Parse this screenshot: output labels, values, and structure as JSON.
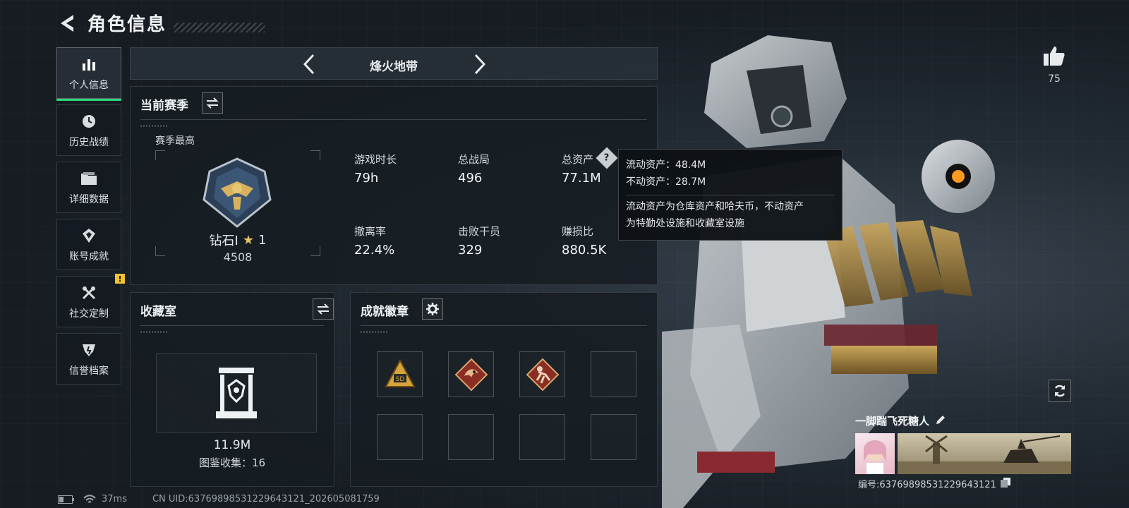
{
  "header": {
    "title": "角色信息"
  },
  "sidebar": {
    "items": [
      {
        "label": "个人信息",
        "icon": "bar-chart-icon",
        "active": true
      },
      {
        "label": "历史战绩",
        "icon": "clock-icon"
      },
      {
        "label": "详细数据",
        "icon": "folder-icon"
      },
      {
        "label": "账号成就",
        "icon": "achievement-icon"
      },
      {
        "label": "社交定制",
        "icon": "tools-icon",
        "badge": "!"
      },
      {
        "label": "信誉档案",
        "icon": "shield-icon"
      }
    ]
  },
  "mode": {
    "title": "烽火地带"
  },
  "season": {
    "title": "当前赛季",
    "best_label": "赛季最高",
    "rank_name": "钻石I",
    "rank_stars": "1",
    "rank_points": "4508",
    "stats": [
      {
        "label": "游戏时长",
        "value": "79h"
      },
      {
        "label": "总战局",
        "value": "496"
      },
      {
        "label": "总资产",
        "value": "77.1M"
      },
      {
        "label": "撤离率",
        "value": "22.4%"
      },
      {
        "label": "击败干员",
        "value": "329"
      },
      {
        "label": "赚损比",
        "value": "880.5K"
      }
    ]
  },
  "tooltip": {
    "liquid": "流动资产：48.4M",
    "fixed": "不动资产：28.7M",
    "desc_line1": "流动资产为仓库资产和哈夫币，不动资产",
    "desc_line2": "为特勤处设施和收藏室设施"
  },
  "collection": {
    "title": "收藏室",
    "value": "11.9M",
    "count_text": "图鉴收集：16"
  },
  "achievements": {
    "title": "成就徽章",
    "badges": [
      "sd-badge",
      "dragon-badge",
      "runner-badge",
      "",
      "",
      "",
      "",
      ""
    ]
  },
  "player": {
    "name": "一脚踹飞死糖人",
    "id_text": "编号:637698985312296431​21",
    "likes": "75"
  },
  "footer": {
    "ping": "37ms",
    "uid": "CN UID:6376989853122964312​1_202605081759"
  },
  "colors": {
    "accent": "#2bd57c",
    "warning": "#f2c230"
  }
}
